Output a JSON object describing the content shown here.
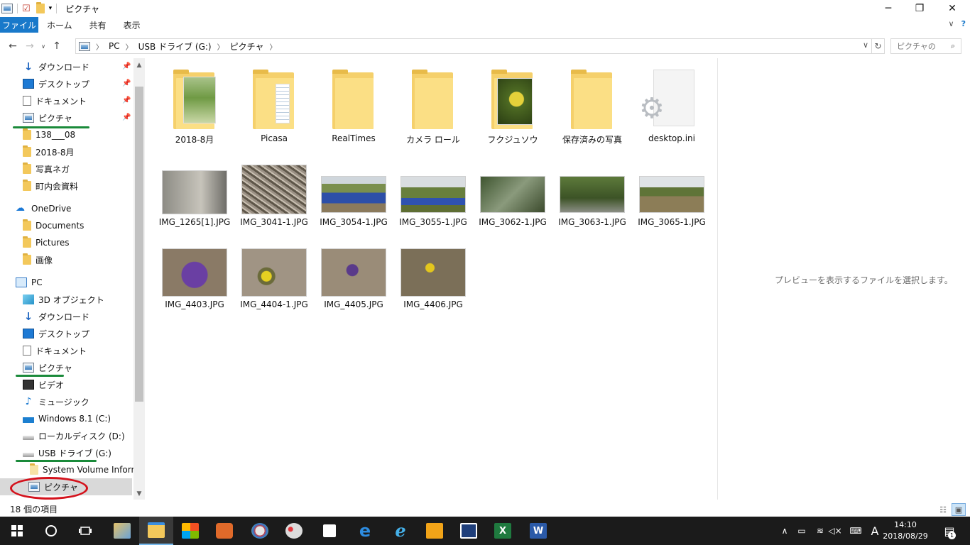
{
  "window": {
    "title": "ピクチャ",
    "minimize": "─",
    "maximize": "❐",
    "close": "✕"
  },
  "ribbon": {
    "tabs": [
      "ファイル",
      "ホーム",
      "共有",
      "表示"
    ],
    "collapse": "∨",
    "help": "?"
  },
  "address": {
    "crumbs": [
      "PC",
      "USB ドライブ (G:)",
      "ピクチャ"
    ],
    "search_placeholder": "ピクチャの"
  },
  "nav": {
    "quick_access": [
      {
        "label": "ダウンロード",
        "icon": "download-icon",
        "pinned": true
      },
      {
        "label": "デスクトップ",
        "icon": "desktop-icon",
        "pinned": true
      },
      {
        "label": "ドキュメント",
        "icon": "document-icon",
        "pinned": true
      },
      {
        "label": "ピクチャ",
        "icon": "pictures-icon",
        "pinned": true
      },
      {
        "label": "138___08",
        "icon": "folder-icon"
      },
      {
        "label": "2018-8月",
        "icon": "folder-icon"
      },
      {
        "label": "写真ネガ",
        "icon": "folder-icon"
      },
      {
        "label": "町内会資料",
        "icon": "folder-icon"
      }
    ],
    "onedrive": {
      "label": "OneDrive",
      "children": [
        "Documents",
        "Pictures",
        "画像"
      ]
    },
    "pc": {
      "label": "PC",
      "children": [
        {
          "label": "3D オブジェクト",
          "icon": "3d-objects-icon"
        },
        {
          "label": "ダウンロード",
          "icon": "download-icon"
        },
        {
          "label": "デスクトップ",
          "icon": "desktop-icon"
        },
        {
          "label": "ドキュメント",
          "icon": "document-icon"
        },
        {
          "label": "ピクチャ",
          "icon": "pictures-icon"
        },
        {
          "label": "ビデオ",
          "icon": "video-icon"
        },
        {
          "label": "ミュージック",
          "icon": "music-icon"
        },
        {
          "label": "Windows 8.1 (C:)",
          "icon": "windows-drive-icon"
        },
        {
          "label": "ローカルディスク (D:)",
          "icon": "drive-icon"
        },
        {
          "label": "USB ドライブ (G:)",
          "icon": "usb-drive-icon"
        }
      ]
    },
    "usb_children": [
      "System Volume Informat",
      "ピクチャ"
    ]
  },
  "files": {
    "folders": [
      "2018-8月",
      "Picasa",
      "RealTimes",
      "カメラ ロール",
      "フクジュソウ",
      "保存済みの写真",
      "desktop.ini"
    ],
    "images_row1": [
      "IMG_1265[1].JPG",
      "IMG_3041-1.JPG",
      "IMG_3054-1.JPG",
      "IMG_3055-1.JPG",
      "IMG_3062-1.JPG",
      "IMG_3063-1.JPG",
      "IMG_3065-1.JPG"
    ],
    "images_row2": [
      "IMG_4403.JPG",
      "IMG_4404-1.JPG",
      "IMG_4405.JPG",
      "IMG_4406.JPG"
    ]
  },
  "preview_text": "プレビューを表示するファイルを選択します。",
  "status": {
    "item_count": "18 個の項目"
  },
  "taskbar": {
    "time": "14:10",
    "date": "2018/08/29",
    "ime": "A",
    "notification_count": "1"
  },
  "colors": {
    "accent": "#1979ca",
    "annotation_green": "#1a8a3a",
    "annotation_red": "#d4121c",
    "taskbar": "#1b1b1b"
  }
}
